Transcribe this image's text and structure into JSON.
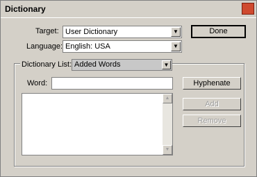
{
  "window": {
    "title": "Dictionary",
    "close_glyph": "✕"
  },
  "target": {
    "label": "Target:",
    "value": "User Dictionary"
  },
  "language": {
    "label": "Language:",
    "value": "English: USA"
  },
  "buttons": {
    "done": "Done",
    "hyphenate": "Hyphenate",
    "add": "Add",
    "remove": "Remove"
  },
  "dictionary_list": {
    "label": "Dictionary List:",
    "value": "Added Words"
  },
  "word": {
    "label": "Word:",
    "value": ""
  },
  "icons": {
    "dropdown_arrow": "▼",
    "scroll_up": "▲",
    "scroll_down": "▼"
  }
}
